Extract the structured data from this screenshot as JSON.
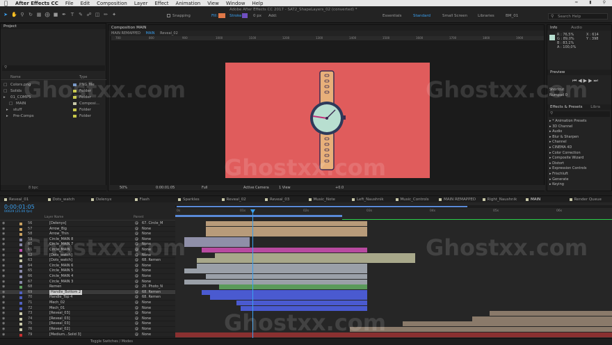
{
  "menubar": {
    "apple": "",
    "app": "After Effects CC",
    "items": [
      "File",
      "Edit",
      "Composition",
      "Layer",
      "Effect",
      "Animation",
      "View",
      "Window",
      "Help"
    ]
  },
  "toolbar": {
    "snapping": "Snapping",
    "fill": "Fill:",
    "stroke": "Stroke:",
    "stroke_px": "0 px",
    "add": "Add:",
    "title": "Adobe After Effects CC 2017 - SAT2_ShapeLayers_02 (converted) *",
    "workspaces": [
      "Essentials",
      "Standard",
      "Small Screen",
      "Libraries",
      "BM_01"
    ],
    "search": "Search Help"
  },
  "project": {
    "title": "Project",
    "search_placeholder": "",
    "col_name": "Name",
    "col_type": "Type",
    "items": [
      {
        "name": "Colors.png",
        "type": "PNG file",
        "color": "#7a9ac8"
      },
      {
        "name": "Solids",
        "type": "Folder",
        "color": "#c8c84a"
      },
      {
        "name": "01_COMPS",
        "type": "Folder",
        "color": "#c8c84a"
      },
      {
        "name": "MAIN",
        "type": "Composi...",
        "color": "#c8c8a8"
      },
      {
        "name": "stuff",
        "type": "Folder",
        "color": "#c8c84a"
      },
      {
        "name": "Pre-Comps",
        "type": "Folder",
        "color": "#c8c84a"
      }
    ],
    "bpc": "8 bpc"
  },
  "composition": {
    "header": "Composition MAIN",
    "breadcrumbs": [
      "MAIN REMAPPED",
      "MAIN",
      "Reveal_02"
    ],
    "ruler": [
      "700",
      "800",
      "900",
      "1000",
      "1100",
      "1200",
      "1300",
      "1400",
      "1500",
      "1600",
      "1700",
      "1800",
      "1900"
    ],
    "zoom": "50%",
    "time": "0:00:01:05",
    "resolution": "Full",
    "camera": "Active Camera",
    "view": "1 View",
    "exposure": "+0.0"
  },
  "info": {
    "tab_info": "Info",
    "tab_audio": "Audio",
    "r": "R : 76,5%",
    "g": "G : 89,0%",
    "b": "B : 83,1%",
    "a": "A : 100,0%",
    "x": "X : 614",
    "y": "Y : 398"
  },
  "preview": {
    "title": "Preview",
    "shortcut_label": "Shortcut",
    "shortcut_value": "Numpad 0"
  },
  "effects": {
    "title": "Effects & Presets",
    "tab2": "Libra",
    "items": [
      "* Animation Presets",
      "3D Channel",
      "Audio",
      "Blur & Sharpen",
      "Channel",
      "CINEMA 4D",
      "Color Correction",
      "Composite Wizard",
      "Distort",
      "Expression Controls",
      "Frischluft",
      "Generate",
      "Keying"
    ]
  },
  "timeline_tabs": [
    "Reveal_01",
    "Dots_watch",
    "Delenyx",
    "Flash",
    "Sparkles",
    "Reveal_02",
    "Reveal_03",
    "Music_Note",
    "Left_Naushnik",
    "Music_Controls",
    "MAIN REMAPPED",
    "Right_Naushnik",
    "MAIN",
    "Render Queue"
  ],
  "timeline": {
    "timecode": "0:00:01:05",
    "fps": "00029 (25.00 fps)",
    "col_layer_name": "Layer Name",
    "col_parent": "Parent",
    "ruler": [
      "0s",
      "01s",
      "02s",
      "03s",
      "04s",
      "05s",
      "06s"
    ],
    "layers": [
      {
        "num": "56",
        "name": "[Delenyx]",
        "parent": "67. Circle_M",
        "color": "#c8a060",
        "bar": [
          0.07,
          0.44,
          "#b89b7a"
        ]
      },
      {
        "num": "57",
        "name": "Arrow_Big",
        "parent": "None",
        "color": "#c8a060",
        "bar": [
          0.07,
          0.44,
          "#b89b7a"
        ]
      },
      {
        "num": "58",
        "name": "Arrow_Thin",
        "parent": "None",
        "color": "#c8a060",
        "bar": [
          0.07,
          0.44,
          "#b89b7a"
        ]
      },
      {
        "num": "59",
        "name": "Circle_MAIN 8",
        "parent": "None",
        "color": "#8888a8",
        "bar": [
          0.02,
          0.17,
          "#8f8fa8"
        ]
      },
      {
        "num": "60",
        "name": "Circle_MAIN 7",
        "parent": "None",
        "color": "#8888a8",
        "bar": [
          0.02,
          0.17,
          "#8f8fa8"
        ]
      },
      {
        "num": "61",
        "name": "Circle_MAIN",
        "parent": "None",
        "color": "#c050b0",
        "bar": [
          0.06,
          0.44,
          "#b84aa0"
        ]
      },
      {
        "num": "62",
        "name": "[Dots_watch]",
        "parent": "None",
        "color": "#c8c8a8",
        "bar": [
          0.09,
          0.55,
          "#a8a88a"
        ]
      },
      {
        "num": "63",
        "name": "[Dots_watch]",
        "parent": "68. Remen",
        "color": "#c8c8a8",
        "bar": [
          0.05,
          0.55,
          "#a8a88a"
        ]
      },
      {
        "num": "64",
        "name": "Circle_MAIN 6",
        "parent": "None",
        "color": "#8888a8",
        "bar": [
          0.05,
          0.44,
          "#9aa0a8"
        ]
      },
      {
        "num": "65",
        "name": "Circle_MAIN 5",
        "parent": "None",
        "color": "#8888a8",
        "bar": [
          0.02,
          0.44,
          "#9aa0a8"
        ]
      },
      {
        "num": "66",
        "name": "Circle_MAIN 4",
        "parent": "None",
        "color": "#8888a8",
        "bar": [
          0.07,
          0.44,
          "#9aa0a8"
        ]
      },
      {
        "num": "67",
        "name": "Circle_MAIN 3",
        "parent": "None",
        "color": "#8888a8",
        "bar": [
          0.02,
          0.44,
          "#9aa0a8"
        ]
      },
      {
        "num": "68",
        "name": "Remen",
        "parent": "20. Photo_N",
        "color": "#60a060",
        "bar": [
          0.1,
          0.44,
          "#5a9a5a"
        ]
      },
      {
        "num": "69",
        "name": "Handle_Bottom 2",
        "parent": "68. Remen",
        "color": "#5060c0",
        "bar": [
          0.06,
          0.44,
          "#4a5ad0"
        ]
      },
      {
        "num": "70",
        "name": "Handle_Top 4",
        "parent": "68. Remen",
        "color": "#5060c0",
        "bar": [
          0.08,
          0.44,
          "#4a5ad0"
        ]
      },
      {
        "num": "71",
        "name": "Mech_02",
        "parent": "None",
        "color": "#5060c0",
        "bar": [
          0.14,
          0.44,
          "#4a5ad0"
        ]
      },
      {
        "num": "72",
        "name": "Mech_01",
        "parent": "None",
        "color": "#5060c0",
        "bar": [
          0.15,
          0.44,
          "#4a5ad0"
        ]
      },
      {
        "num": "73",
        "name": "[Reveal_03]",
        "parent": "None",
        "color": "#c8c8a8",
        "bar": [
          0.72,
          1.0,
          "#8a7a6a"
        ]
      },
      {
        "num": "74",
        "name": "[Reveal_03]",
        "parent": "None",
        "color": "#c8c8a8",
        "bar": [
          0.68,
          1.0,
          "#8a7a6a"
        ]
      },
      {
        "num": "75",
        "name": "[Reveal_03]",
        "parent": "None",
        "color": "#c8c8a8",
        "bar": [
          0.52,
          1.0,
          "#8a7a6a"
        ]
      },
      {
        "num": "76",
        "name": "[Reveal_02]",
        "parent": "None",
        "color": "#c8c8a8",
        "bar": [
          0.4,
          1.0,
          "#8a7a6a"
        ]
      },
      {
        "num": "79",
        "name": "[Medium...Solid 3]",
        "parent": "None",
        "color": "#c83030",
        "bar": [
          0.0,
          1.0,
          "#8a3030"
        ]
      }
    ],
    "toggle": "Toggle Switches / Modes"
  },
  "watermark": "Ghostxx.com",
  "colors": {
    "canvas": "#e05c5c",
    "strap": "#e8b07a",
    "face": "#b8dfd0",
    "accent": "#3aa0f0",
    "work_area": "#5a8ad8",
    "green": "#2ad04a"
  }
}
